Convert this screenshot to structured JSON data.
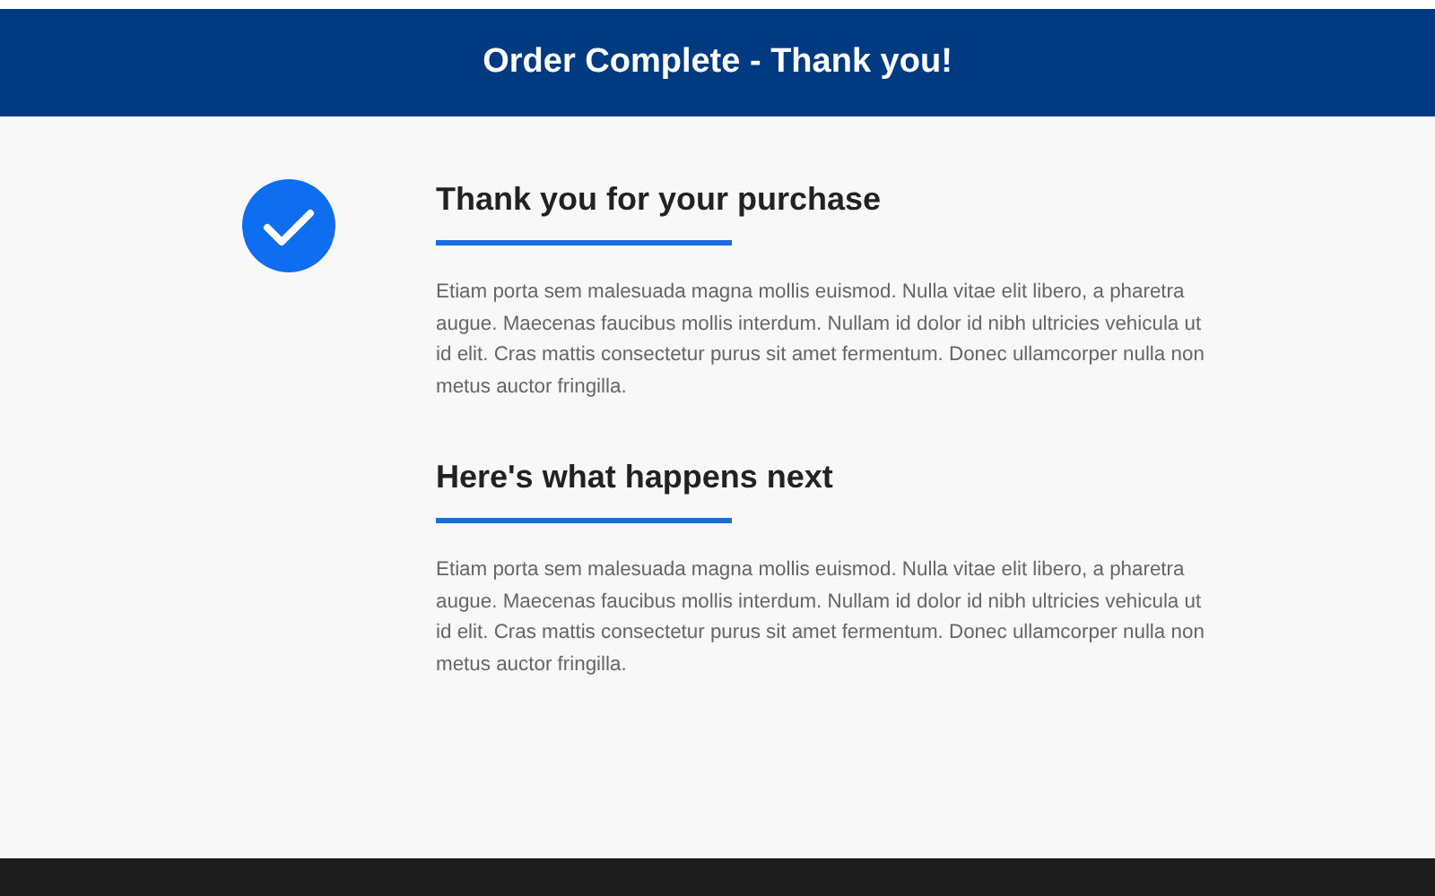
{
  "header": {
    "title": "Order Complete - Thank you!"
  },
  "sections": [
    {
      "heading": "Thank you for your purchase",
      "text": "Etiam porta sem malesuada magna mollis euismod. Nulla vitae elit libero, a pharetra augue. Maecenas faucibus mollis interdum. Nullam id dolor id nibh ultricies vehicula ut id elit. Cras mattis consectetur purus sit amet fermentum. Donec ullamcorper nulla non metus auctor fringilla."
    },
    {
      "heading": "Here's what happens next",
      "text": "Etiam porta sem malesuada magna mollis euismod. Nulla vitae elit libero, a pharetra augue. Maecenas faucibus mollis interdum. Nullam id dolor id nibh ultricies vehicula ut id elit. Cras mattis consectetur purus sit amet fermentum. Donec ullamcorper nulla non metus auctor fringilla."
    }
  ]
}
